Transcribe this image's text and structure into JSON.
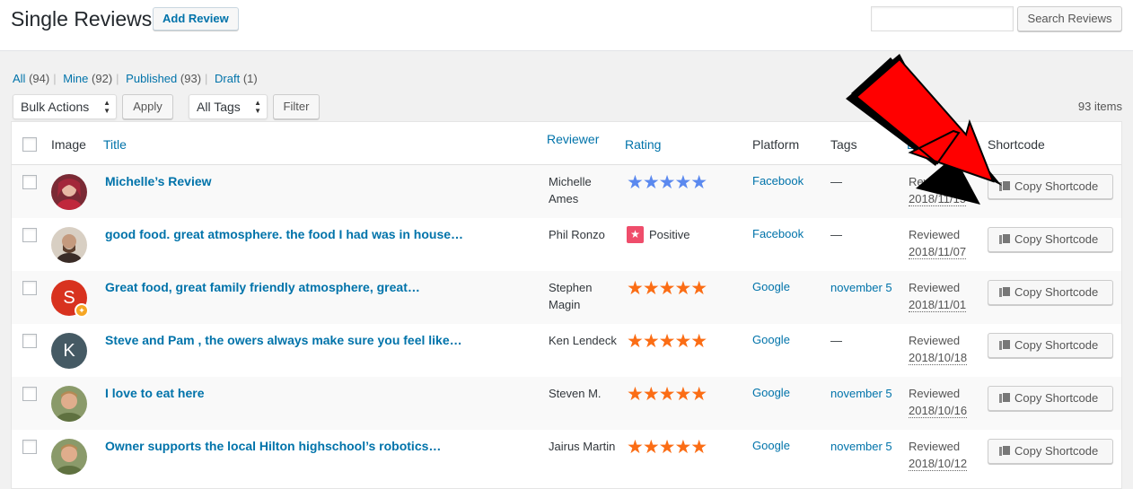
{
  "header": {
    "title": "Single Reviews",
    "add_label": "Add Review",
    "search_button": "Search Reviews",
    "search_value": ""
  },
  "views": [
    {
      "label": "All",
      "count": "(94)"
    },
    {
      "label": "Mine",
      "count": "(92)"
    },
    {
      "label": "Published",
      "count": "(93)"
    },
    {
      "label": "Draft",
      "count": "(1)"
    }
  ],
  "toolbar": {
    "bulk_value": "Bulk Actions",
    "apply": "Apply",
    "tags_value": "All Tags",
    "filter": "Filter",
    "items_count": "93 items"
  },
  "columns": {
    "image": "Image",
    "title": "Title",
    "reviewer": "Reviewer",
    "rating": "Rating",
    "platform": "Platform",
    "tags": "Tags",
    "date": "Da",
    "shortcode": "Shortcode"
  },
  "rows": [
    {
      "title": "Michelle’s Review",
      "reviewer": "Michelle Ames",
      "stars": 5,
      "platform": "Facebook",
      "tags": "—",
      "status": "Reviewed",
      "date": "2018/11/15",
      "button": "Copy Shortcode"
    },
    {
      "title": "good food. great atmosphere. the food I had was in house…",
      "reviewer": "Phil Ronzo",
      "rating_text": "Positive",
      "platform": "Facebook",
      "tags": "—",
      "status": "Reviewed",
      "date": "2018/11/07",
      "button": "Copy Shortcode"
    },
    {
      "title": "Great food, great family friendly atmosphere, great…",
      "reviewer": "Stephen Magin",
      "stars": 5,
      "platform": "Google",
      "tags": "november 5",
      "status": "Reviewed",
      "date": "2018/11/01",
      "button": "Copy Shortcode",
      "avatar_letter": "S"
    },
    {
      "title": "Steve and Pam , the owers always make sure you feel like…",
      "reviewer": "Ken Lendeck",
      "stars": 5,
      "platform": "Google",
      "tags": "—",
      "status": "Reviewed",
      "date": "2018/10/18",
      "button": "Copy Shortcode",
      "avatar_letter": "K"
    },
    {
      "title": "I love to eat here",
      "reviewer": "Steven M.",
      "stars": 5,
      "platform": "Google",
      "tags": "november 5",
      "status": "Reviewed",
      "date": "2018/10/16",
      "button": "Copy Shortcode"
    },
    {
      "title": "Owner supports the local Hilton highschool’s robotics…",
      "reviewer": "Jairus Martin",
      "stars": 5,
      "platform": "Google",
      "tags": "november 5",
      "status": "Reviewed",
      "date": "2018/10/12",
      "button": "Copy Shortcode"
    }
  ],
  "stars_glyph": "★★★★★",
  "colors": {
    "link": "#0073aa",
    "facebook_star": "#5b89ef",
    "google_star": "#fb6d15",
    "arrow": "#ff0000"
  }
}
